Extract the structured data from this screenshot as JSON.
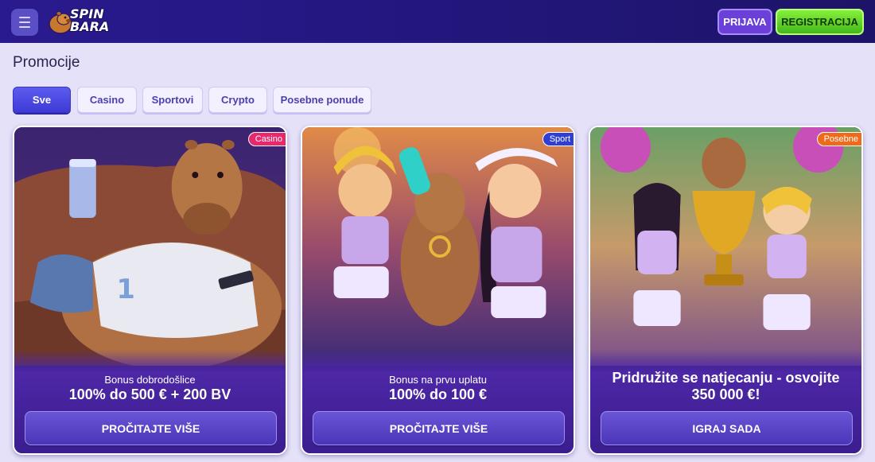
{
  "header": {
    "logo_line1": "SPIN",
    "logo_line2": "BARA",
    "login_label": "PRIJAVA",
    "register_label": "REGISTRACIJA"
  },
  "page": {
    "title": "Promocije"
  },
  "filters": [
    {
      "label": "Sve",
      "active": true
    },
    {
      "label": "Casino",
      "active": false
    },
    {
      "label": "Sportovi",
      "active": false
    },
    {
      "label": "Crypto",
      "active": false
    },
    {
      "label": "Posebne ponude",
      "active": false
    }
  ],
  "promos": [
    {
      "tag": "Casino",
      "tag_color": "#e8286e",
      "subtitle": "Bonus dobrodošlice",
      "title": "100% do 500 € + 200 BV",
      "button": "PROČITAJTE VIŠE"
    },
    {
      "tag": "Sport",
      "tag_color": "#2f3fd6",
      "subtitle": "Bonus na prvu uplatu",
      "title": "100% do 100 €",
      "button": "PROČITAJTE VIŠE"
    },
    {
      "tag": "Posebne",
      "tag_color": "#f06a1c",
      "subtitle": "",
      "title_line1": "Pridružite se natjecanju - osvojite",
      "title_line2": "350 000 €!",
      "button": "IGRAJ SADA"
    }
  ],
  "colors": {
    "header_bg": "#241781",
    "page_bg": "#e4e1f8",
    "accent_green": "#43b81b",
    "accent_purple": "#6b40d8"
  }
}
